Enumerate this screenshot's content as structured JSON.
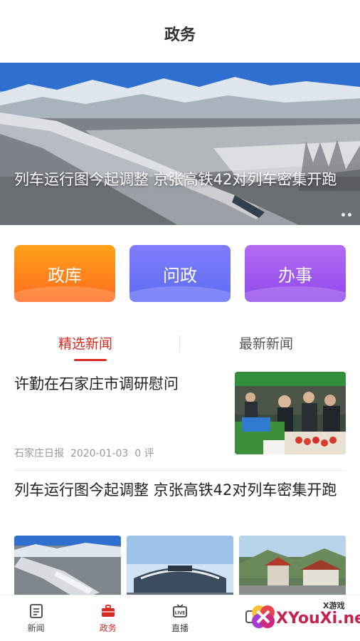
{
  "header": {
    "title": "政务"
  },
  "banner": {
    "caption": "列车运行图今起调整 京张高铁42对列车密集开跑",
    "active_index": 1,
    "slide_count": 2
  },
  "quick_actions": [
    {
      "label": "政库"
    },
    {
      "label": "问政"
    },
    {
      "label": "办事"
    }
  ],
  "news_tabs": {
    "selected": "精选新闻",
    "other": "最新新闻"
  },
  "news": [
    {
      "title": "许勤在石家庄市调研慰问",
      "source": "石家庄日报",
      "date": "2020-01-03",
      "comments": "0 评"
    },
    {
      "title": "列车运行图今起调整 京张高铁42对列车密集开跑"
    }
  ],
  "tabbar": [
    {
      "label": "新闻",
      "icon": "news-doc-icon"
    },
    {
      "label": "政务",
      "icon": "briefcase-icon",
      "active": true
    },
    {
      "label": "直播",
      "icon": "live-tv-icon"
    },
    {
      "label": "",
      "icon": "hidden-icon"
    },
    {
      "label": "",
      "icon": "hidden-icon"
    }
  ],
  "watermark": {
    "brand": "XYouXi.net",
    "small": "X游戏"
  },
  "colors": {
    "accent": "#d62a22",
    "orange": "#ff8a1c",
    "blue": "#6a70f5",
    "purple": "#a05bef"
  }
}
